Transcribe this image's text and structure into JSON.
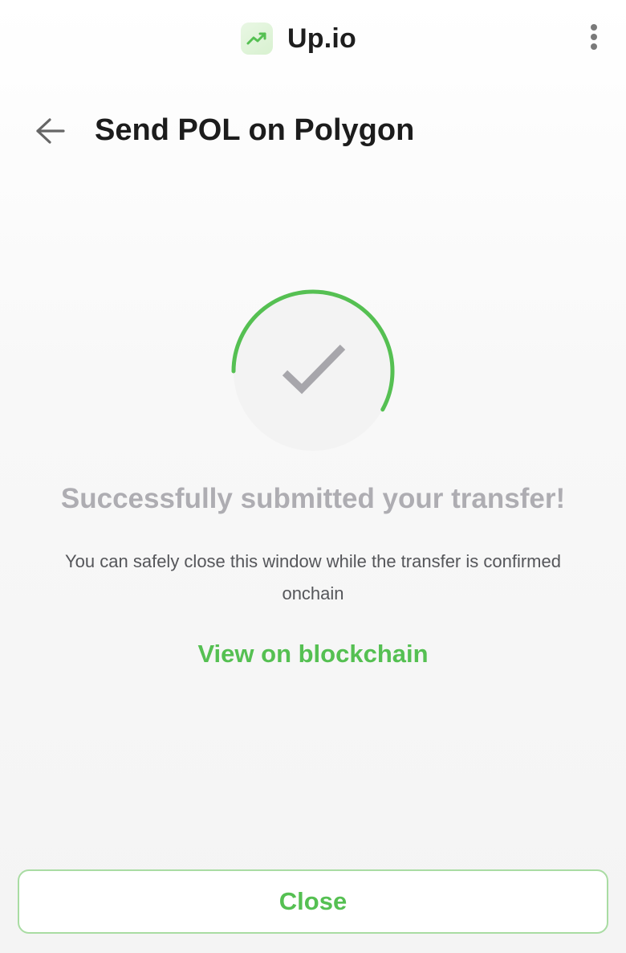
{
  "header": {
    "app_name": "Up.io",
    "logo_icon": "trending-up-icon",
    "menu_icon": "more-vertical-icon"
  },
  "nav": {
    "back_icon": "arrow-left-icon",
    "title": "Send POL on Polygon"
  },
  "status": {
    "icon": "check-icon",
    "progress_fraction": 0.58,
    "headline": "Successfully submitted your transfer!",
    "message": "You can safely close this window while the transfer is confirmed onchain",
    "link_label": "View on blockchain"
  },
  "actions": {
    "close_label": "Close"
  },
  "colors": {
    "accent": "#55c052",
    "muted_text": "#aeadb2",
    "check_mark": "#a7a6ab",
    "circle_fill": "#f3f3f3"
  }
}
